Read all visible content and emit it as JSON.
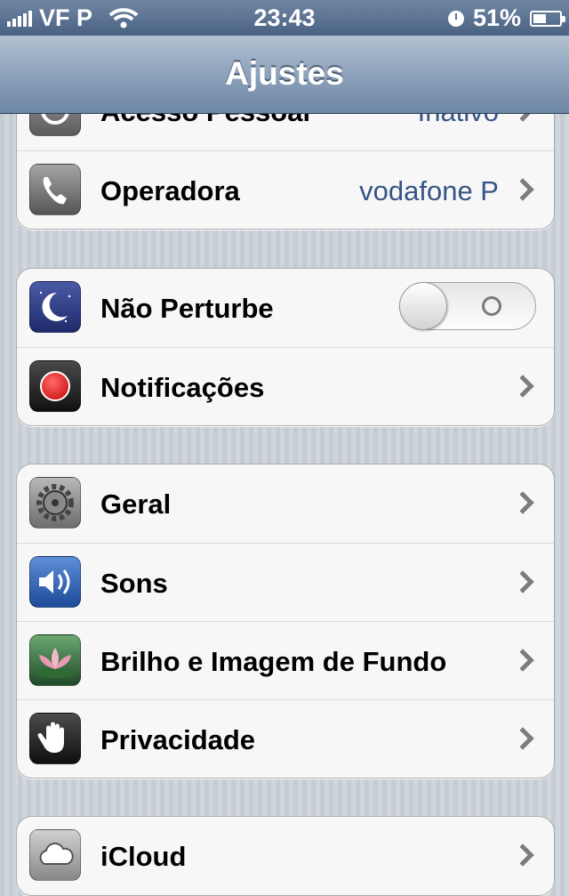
{
  "status_bar": {
    "carrier": "VF P",
    "time": "23:43",
    "battery": "51%",
    "battery_level": 0.51
  },
  "nav": {
    "title": "Ajustes"
  },
  "groups": [
    {
      "rows": [
        {
          "label": "Acesso Pessoal",
          "value": "Inativo",
          "icon": "hotspot-icon"
        },
        {
          "label": "Operadora",
          "value": "vodafone P",
          "icon": "phone-icon"
        }
      ]
    },
    {
      "rows": [
        {
          "label": "Não Perturbe",
          "icon": "moon-icon",
          "toggle": "off"
        },
        {
          "label": "Notificações",
          "icon": "notifications-icon"
        }
      ]
    },
    {
      "rows": [
        {
          "label": "Geral",
          "icon": "gear-icon"
        },
        {
          "label": "Sons",
          "icon": "speaker-icon"
        },
        {
          "label": "Brilho e Imagem de Fundo",
          "icon": "wallpaper-icon"
        },
        {
          "label": "Privacidade",
          "icon": "hand-icon"
        }
      ]
    },
    {
      "rows": [
        {
          "label": "iCloud",
          "icon": "icloud-icon"
        }
      ]
    }
  ],
  "colors": {
    "value_text": "#385487",
    "navbar": "#8da2bb",
    "background": "#cbd2d8"
  }
}
